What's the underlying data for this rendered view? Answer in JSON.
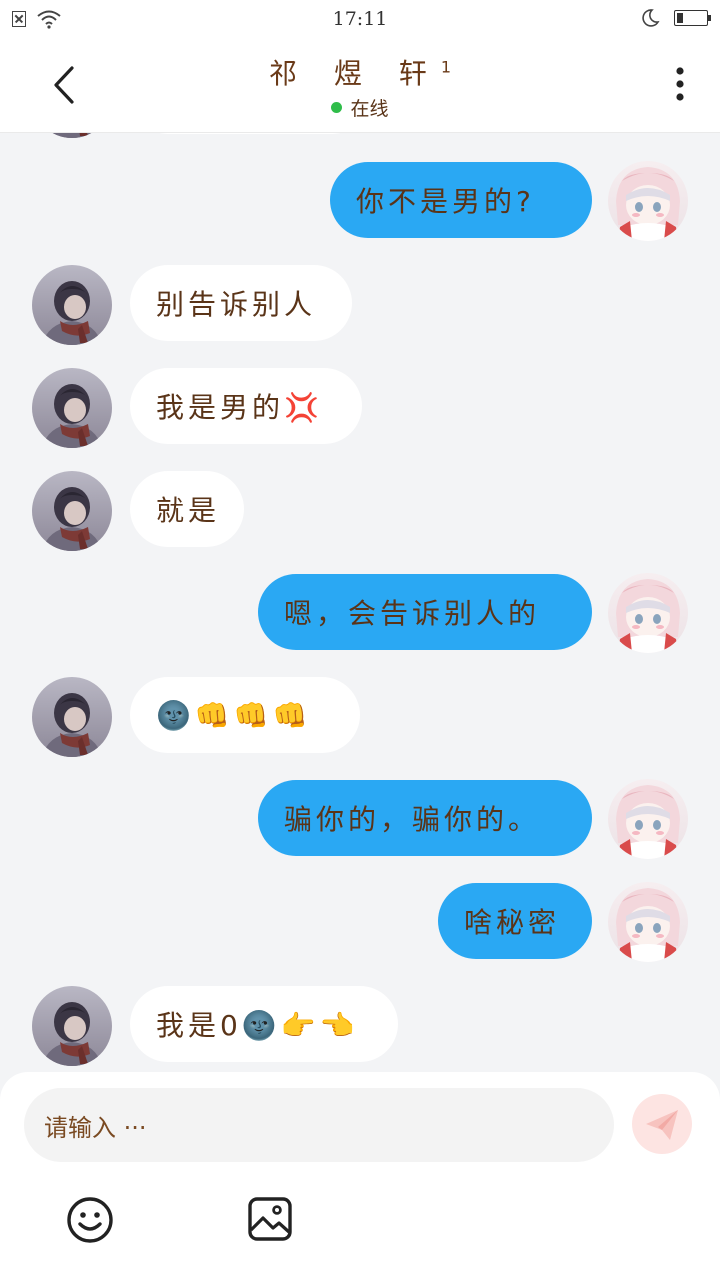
{
  "status_bar": {
    "time": "17:11"
  },
  "header": {
    "contact_name": "祁 煜 轩",
    "name_superscript": "1",
    "status": "在线"
  },
  "messages": [
    {
      "side": "in",
      "text": ""
    },
    {
      "side": "out",
      "text": "你不是男的?"
    },
    {
      "side": "in",
      "text": "别告诉别人"
    },
    {
      "side": "in",
      "text": "我是男的💢"
    },
    {
      "side": "in",
      "text": "就是"
    },
    {
      "side": "out",
      "text": "嗯，会告诉别人的"
    },
    {
      "side": "in",
      "text": "🌚👊👊👊"
    },
    {
      "side": "out",
      "text": "骗你的，骗你的。"
    },
    {
      "side": "out",
      "text": "啥秘密"
    },
    {
      "side": "in",
      "text": "我是0🌚👉👈"
    }
  ],
  "composer": {
    "placeholder": "请输入 ···",
    "send_icon": "send-icon",
    "emoji_icon": "smiley-icon",
    "image_icon": "image-icon"
  },
  "colors": {
    "outgoing_bubble": "#2aa8f3",
    "incoming_bubble": "#ffffff",
    "online": "#2fbd4a"
  }
}
